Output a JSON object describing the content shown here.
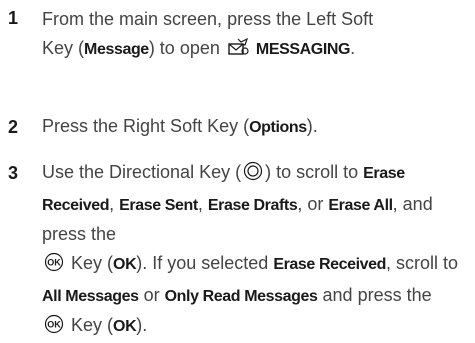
{
  "steps": [
    {
      "number": "1",
      "line1": "From the main screen, press the Left Soft",
      "pre": "Key (",
      "bold1": "Message",
      "mid": ") to open",
      "bold2": "MESSAGING",
      "post": "."
    },
    {
      "number": "2",
      "pre": "Press the Right Soft Key (",
      "bold1": "Options",
      "post": ")."
    },
    {
      "number": "3",
      "t1": "Use the Directional Key (",
      "t2": ") to scroll to",
      "b1": "Erase Received",
      "t3": ",",
      "b2": "Erase Sent",
      "t4": ",",
      "b3": "Erase Drafts",
      "t5": ", or",
      "b4": "Erase All",
      "t6": ", and press the",
      "t7": "Key (",
      "b5": "OK",
      "t8": "). If you selected",
      "b6": "Erase Received",
      "t9": ", scroll to",
      "b7": "All Messages",
      "t10": "or",
      "b8": "Only Read Messages",
      "t11": "and press the",
      "t12": "Key (",
      "b9": "OK",
      "t13": ")."
    }
  ],
  "icons": {
    "messaging": "messaging-envelope-icon",
    "directional": "directional-key-icon",
    "ok": "ok-key-icon"
  }
}
